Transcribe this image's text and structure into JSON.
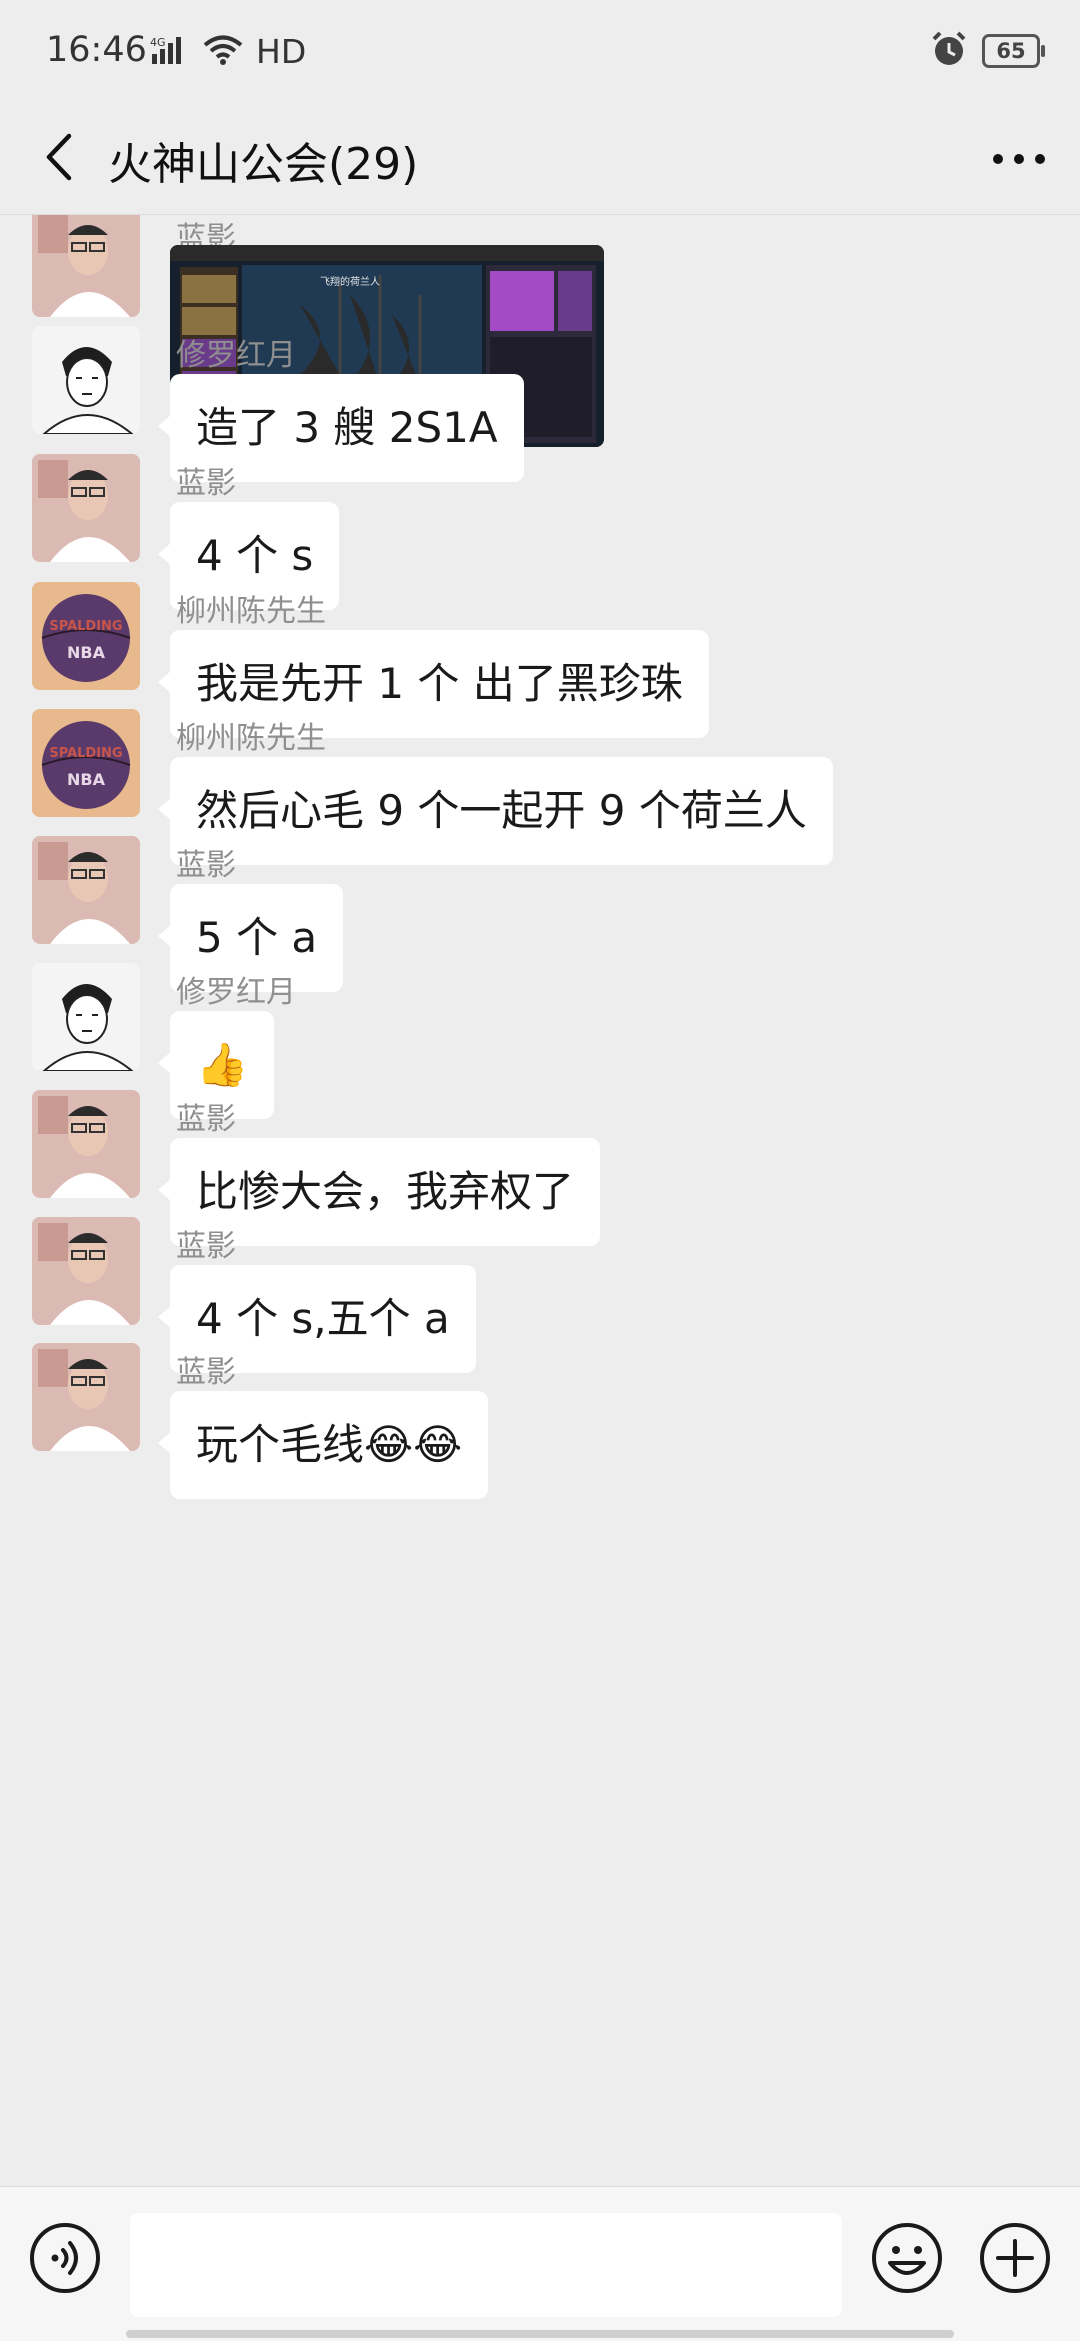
{
  "status_bar": {
    "time": "16:46",
    "network": "4G",
    "hd": "HD",
    "battery": "65",
    "icons": [
      "signal-icon",
      "wifi-icon",
      "alarm-icon",
      "battery-icon"
    ]
  },
  "nav": {
    "title": "火神山公会(29)",
    "back_icon": "chevron-left-icon",
    "more_icon": "more-dots-icon"
  },
  "messages": [
    {
      "sender": "蓝影",
      "type": "image",
      "content": "飞翔的荷兰人"
    },
    {
      "sender": "修罗红月",
      "type": "text",
      "content": "造了 3 艘 2S1A"
    },
    {
      "sender": "蓝影",
      "type": "text",
      "content": "4 个 s"
    },
    {
      "sender": "柳州陈先生",
      "type": "text",
      "content": "我是先开 1 个 出了黑珍珠"
    },
    {
      "sender": "柳州陈先生",
      "type": "text",
      "content": "然后心毛 9 个一起开  9 个荷兰人"
    },
    {
      "sender": "蓝影",
      "type": "text",
      "content": "5 个 a"
    },
    {
      "sender": "修罗红月",
      "type": "emoji",
      "content": "👍"
    },
    {
      "sender": "蓝影",
      "type": "text",
      "content": "比惨大会，我弃权了"
    },
    {
      "sender": "蓝影",
      "type": "text",
      "content": "4 个 s,五个 a"
    },
    {
      "sender": "蓝影",
      "type": "text",
      "content": "玩个毛线😂😂"
    }
  ],
  "input_bar": {
    "placeholder": "",
    "voice_icon": "voice-icon",
    "emoji_icon": "emoji-icon",
    "plus_icon": "plus-icon"
  },
  "avatar_text": {
    "liuzhou": "SPALDING",
    "liuzhou_2": "NBA"
  }
}
